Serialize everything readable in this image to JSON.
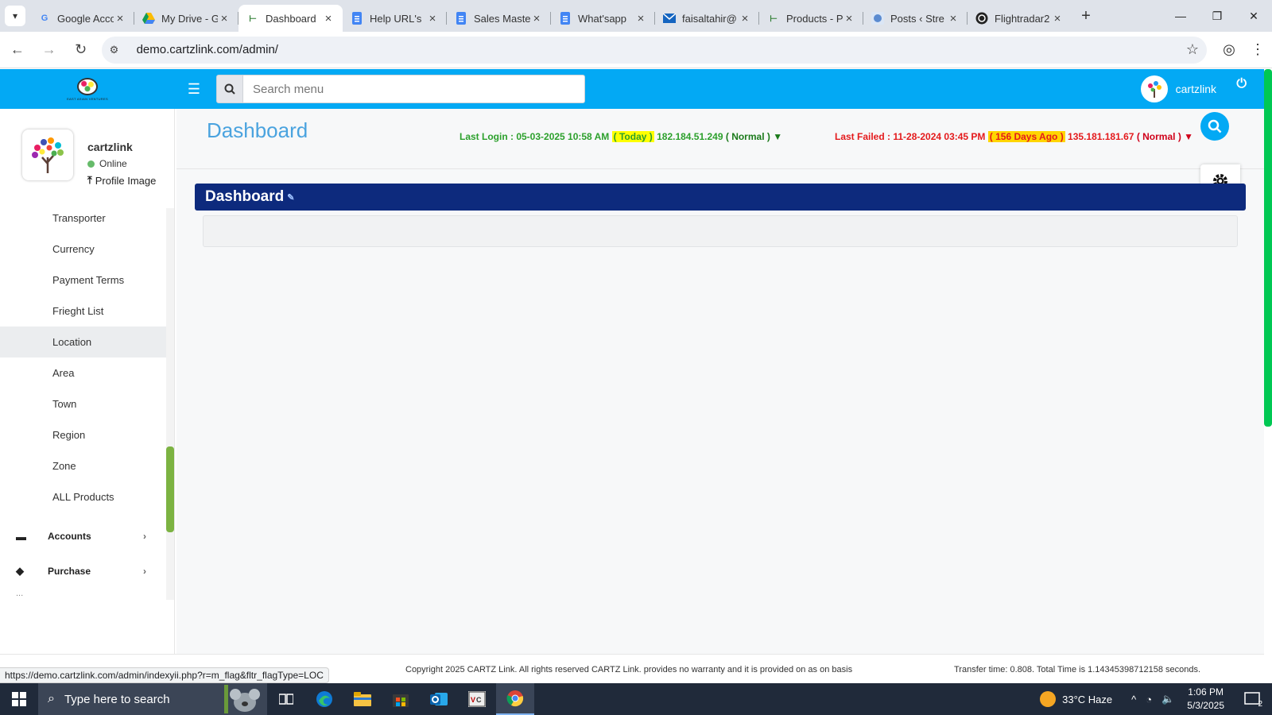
{
  "browser": {
    "tabs": [
      {
        "title": "Google Account",
        "icon": "google-icon"
      },
      {
        "title": "My Drive - Google Drive",
        "icon": "drive-icon"
      },
      {
        "title": "Dashboard",
        "icon": "cartz-icon",
        "active": true
      },
      {
        "title": "Help URL's",
        "icon": "docs-icon"
      },
      {
        "title": "Sales Master",
        "icon": "docs-icon"
      },
      {
        "title": "What'sapp",
        "icon": "docs-icon"
      },
      {
        "title": "faisaltahir@",
        "icon": "mail-icon"
      },
      {
        "title": "Products - P",
        "icon": "cartz-icon"
      },
      {
        "title": "Posts ‹ Stre",
        "icon": "wordpress-icon"
      },
      {
        "title": "Flightradar2",
        "icon": "flightradar-icon"
      }
    ],
    "url": "demo.cartzlink.com/admin/",
    "status_url": "https://demo.cartzlink.com/admin/indexyii.php?r=m_flag&fltr_flagType=LOC"
  },
  "header": {
    "search_placeholder": "Search menu",
    "username": "cartzlink",
    "logo_tagline": "EAST ASIAN VENTURES"
  },
  "sidebar": {
    "profile": {
      "name": "cartzlink",
      "status": "Online",
      "profile_image_label": "Profile Image"
    },
    "items": [
      {
        "label": "Transporter"
      },
      {
        "label": "Currency"
      },
      {
        "label": "Payment Terms"
      },
      {
        "label": "Frieght List"
      },
      {
        "label": "Location",
        "hover": true
      },
      {
        "label": "Area"
      },
      {
        "label": "Town"
      },
      {
        "label": "Region"
      },
      {
        "label": "Zone"
      },
      {
        "label": "ALL Products"
      }
    ],
    "sections": [
      {
        "label": "Accounts",
        "icon": "briefcase-icon"
      },
      {
        "label": "Purchase",
        "icon": "tags-icon"
      }
    ],
    "more": "..."
  },
  "main": {
    "page_title": "Dashboard",
    "last_login": {
      "label": "Last Login : 05-03-2025 10:58 AM",
      "tag": "( Today )",
      "ip": "182.184.51.249",
      "mode": "( Normal ) ▼"
    },
    "last_failed": {
      "label": "Last Failed : 11-28-2024 03:45 PM",
      "tag": "( 156 Days Ago )",
      "ip": "135.181.181.67",
      "mode": "( Normal ) ▼"
    },
    "panel_title": "Dashboard"
  },
  "footer": {
    "copyright": "Copyright 2025 CARTZ Link. All rights reserved CARTZ Link. provides no warranty and it is provided on as on basis",
    "transfer_time": "Transfer time: 0.808. Total Time is 1.14345398712158 seconds."
  },
  "taskbar": {
    "search_placeholder": "Type here to search",
    "weather": "33°C  Haze",
    "time": "1:06 PM",
    "date": "5/3/2025",
    "notifications": "2"
  },
  "colors": {
    "header_bg": "#03a9f4",
    "panel_bar": "#0d2a7d",
    "login_green": "#2ca02c",
    "failed_red": "#e41a1c"
  }
}
